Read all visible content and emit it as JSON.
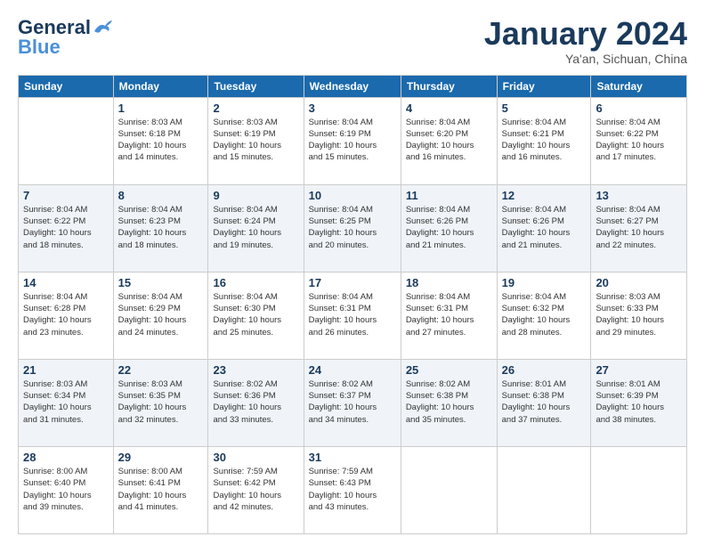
{
  "header": {
    "logo_line1": "General",
    "logo_line2": "Blue",
    "month": "January 2024",
    "location": "Ya'an, Sichuan, China"
  },
  "weekdays": [
    "Sunday",
    "Monday",
    "Tuesday",
    "Wednesday",
    "Thursday",
    "Friday",
    "Saturday"
  ],
  "weeks": [
    [
      {
        "day": "",
        "info": ""
      },
      {
        "day": "1",
        "info": "Sunrise: 8:03 AM\nSunset: 6:18 PM\nDaylight: 10 hours\nand 14 minutes."
      },
      {
        "day": "2",
        "info": "Sunrise: 8:03 AM\nSunset: 6:19 PM\nDaylight: 10 hours\nand 15 minutes."
      },
      {
        "day": "3",
        "info": "Sunrise: 8:04 AM\nSunset: 6:19 PM\nDaylight: 10 hours\nand 15 minutes."
      },
      {
        "day": "4",
        "info": "Sunrise: 8:04 AM\nSunset: 6:20 PM\nDaylight: 10 hours\nand 16 minutes."
      },
      {
        "day": "5",
        "info": "Sunrise: 8:04 AM\nSunset: 6:21 PM\nDaylight: 10 hours\nand 16 minutes."
      },
      {
        "day": "6",
        "info": "Sunrise: 8:04 AM\nSunset: 6:22 PM\nDaylight: 10 hours\nand 17 minutes."
      }
    ],
    [
      {
        "day": "7",
        "info": "Sunrise: 8:04 AM\nSunset: 6:22 PM\nDaylight: 10 hours\nand 18 minutes."
      },
      {
        "day": "8",
        "info": "Sunrise: 8:04 AM\nSunset: 6:23 PM\nDaylight: 10 hours\nand 18 minutes."
      },
      {
        "day": "9",
        "info": "Sunrise: 8:04 AM\nSunset: 6:24 PM\nDaylight: 10 hours\nand 19 minutes."
      },
      {
        "day": "10",
        "info": "Sunrise: 8:04 AM\nSunset: 6:25 PM\nDaylight: 10 hours\nand 20 minutes."
      },
      {
        "day": "11",
        "info": "Sunrise: 8:04 AM\nSunset: 6:26 PM\nDaylight: 10 hours\nand 21 minutes."
      },
      {
        "day": "12",
        "info": "Sunrise: 8:04 AM\nSunset: 6:26 PM\nDaylight: 10 hours\nand 21 minutes."
      },
      {
        "day": "13",
        "info": "Sunrise: 8:04 AM\nSunset: 6:27 PM\nDaylight: 10 hours\nand 22 minutes."
      }
    ],
    [
      {
        "day": "14",
        "info": "Sunrise: 8:04 AM\nSunset: 6:28 PM\nDaylight: 10 hours\nand 23 minutes."
      },
      {
        "day": "15",
        "info": "Sunrise: 8:04 AM\nSunset: 6:29 PM\nDaylight: 10 hours\nand 24 minutes."
      },
      {
        "day": "16",
        "info": "Sunrise: 8:04 AM\nSunset: 6:30 PM\nDaylight: 10 hours\nand 25 minutes."
      },
      {
        "day": "17",
        "info": "Sunrise: 8:04 AM\nSunset: 6:31 PM\nDaylight: 10 hours\nand 26 minutes."
      },
      {
        "day": "18",
        "info": "Sunrise: 8:04 AM\nSunset: 6:31 PM\nDaylight: 10 hours\nand 27 minutes."
      },
      {
        "day": "19",
        "info": "Sunrise: 8:04 AM\nSunset: 6:32 PM\nDaylight: 10 hours\nand 28 minutes."
      },
      {
        "day": "20",
        "info": "Sunrise: 8:03 AM\nSunset: 6:33 PM\nDaylight: 10 hours\nand 29 minutes."
      }
    ],
    [
      {
        "day": "21",
        "info": "Sunrise: 8:03 AM\nSunset: 6:34 PM\nDaylight: 10 hours\nand 31 minutes."
      },
      {
        "day": "22",
        "info": "Sunrise: 8:03 AM\nSunset: 6:35 PM\nDaylight: 10 hours\nand 32 minutes."
      },
      {
        "day": "23",
        "info": "Sunrise: 8:02 AM\nSunset: 6:36 PM\nDaylight: 10 hours\nand 33 minutes."
      },
      {
        "day": "24",
        "info": "Sunrise: 8:02 AM\nSunset: 6:37 PM\nDaylight: 10 hours\nand 34 minutes."
      },
      {
        "day": "25",
        "info": "Sunrise: 8:02 AM\nSunset: 6:38 PM\nDaylight: 10 hours\nand 35 minutes."
      },
      {
        "day": "26",
        "info": "Sunrise: 8:01 AM\nSunset: 6:38 PM\nDaylight: 10 hours\nand 37 minutes."
      },
      {
        "day": "27",
        "info": "Sunrise: 8:01 AM\nSunset: 6:39 PM\nDaylight: 10 hours\nand 38 minutes."
      }
    ],
    [
      {
        "day": "28",
        "info": "Sunrise: 8:00 AM\nSunset: 6:40 PM\nDaylight: 10 hours\nand 39 minutes."
      },
      {
        "day": "29",
        "info": "Sunrise: 8:00 AM\nSunset: 6:41 PM\nDaylight: 10 hours\nand 41 minutes."
      },
      {
        "day": "30",
        "info": "Sunrise: 7:59 AM\nSunset: 6:42 PM\nDaylight: 10 hours\nand 42 minutes."
      },
      {
        "day": "31",
        "info": "Sunrise: 7:59 AM\nSunset: 6:43 PM\nDaylight: 10 hours\nand 43 minutes."
      },
      {
        "day": "",
        "info": ""
      },
      {
        "day": "",
        "info": ""
      },
      {
        "day": "",
        "info": ""
      }
    ]
  ]
}
